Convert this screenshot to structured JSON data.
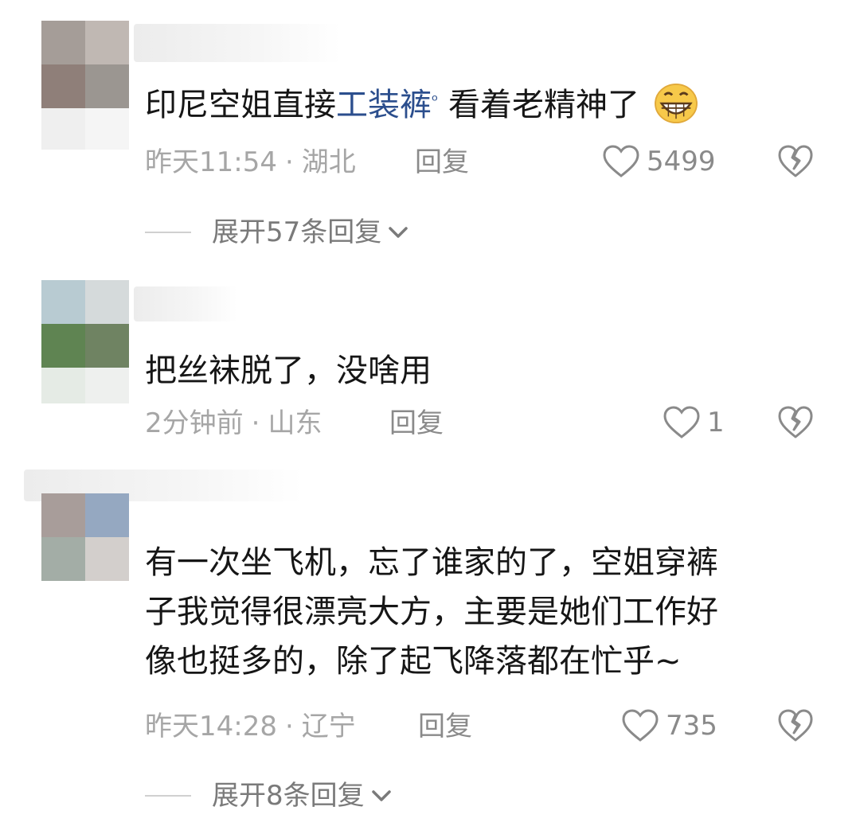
{
  "comments": [
    {
      "text_before": "印尼空姐直接",
      "link": "工装裤",
      "text_after": "看着老精神了",
      "emoji": "grinning-face-emoji",
      "time": "昨天11:54",
      "location": "湖北",
      "reply": "回复",
      "likes": "5499",
      "expand": "展开57条回复"
    },
    {
      "text": "把丝袜脱了，没啥用",
      "time": "2分钟前",
      "location": "山东",
      "reply": "回复",
      "likes": "1"
    },
    {
      "lines": [
        "有一次坐飞机，忘了谁家的了，空姐穿裤",
        "子我觉得很漂亮大方，主要是她们工作好",
        "像也挺多的，除了起飞降落都在忙乎~"
      ],
      "time": "昨天14:28",
      "location": "辽宁",
      "reply": "回复",
      "likes": "735",
      "expand": "展开8条回复"
    }
  ],
  "separator": "·",
  "colors": {
    "link": "#2b4e8d",
    "meta": "#a6a6a6",
    "text": "#161616"
  }
}
